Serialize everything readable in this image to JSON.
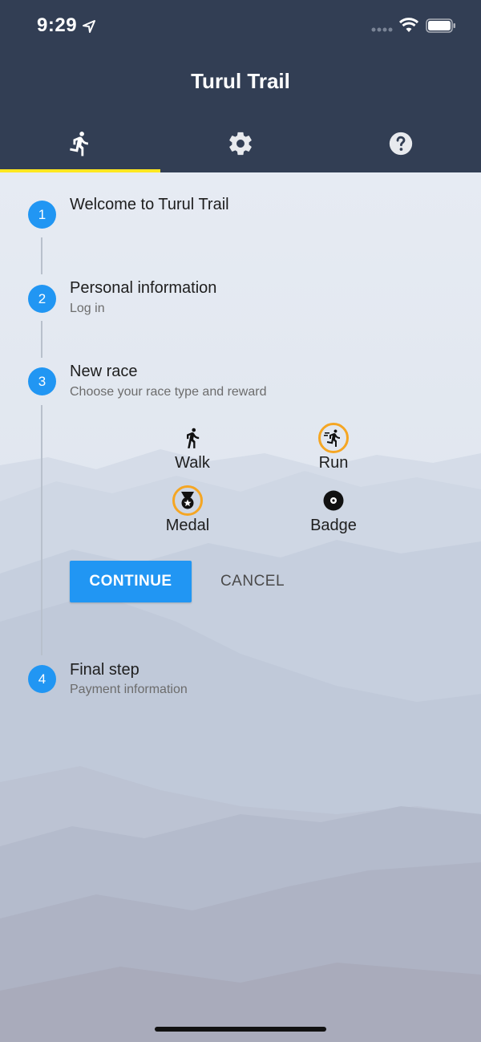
{
  "status_bar": {
    "time": "9:29"
  },
  "app": {
    "title": "Turul Trail"
  },
  "tabs": [
    {
      "icon": "running-icon",
      "active": true
    },
    {
      "icon": "gear-icon",
      "active": false
    },
    {
      "icon": "help-icon",
      "active": false
    }
  ],
  "steps": [
    {
      "number": "1",
      "title": "Welcome to Turul Trail",
      "subtitle": ""
    },
    {
      "number": "2",
      "title": "Personal information",
      "subtitle": "Log in"
    },
    {
      "number": "3",
      "title": "New race",
      "subtitle": "Choose your race type and reward"
    },
    {
      "number": "4",
      "title": "Final step",
      "subtitle": "Payment information"
    }
  ],
  "race_options": {
    "walk": {
      "label": "Walk",
      "icon": "walk-icon",
      "selected": false
    },
    "run": {
      "label": "Run",
      "icon": "run-icon",
      "selected": true
    },
    "medal": {
      "label": "Medal",
      "icon": "medal-icon",
      "selected": true
    },
    "badge": {
      "label": "Badge",
      "icon": "badge-icon",
      "selected": false
    }
  },
  "actions": {
    "continue_label": "CONTINUE",
    "cancel_label": "CANCEL"
  },
  "colors": {
    "header": "#323e54",
    "accent": "#2196f3",
    "tab_indicator": "#ffe720",
    "selected_ring": "#f5a623"
  }
}
